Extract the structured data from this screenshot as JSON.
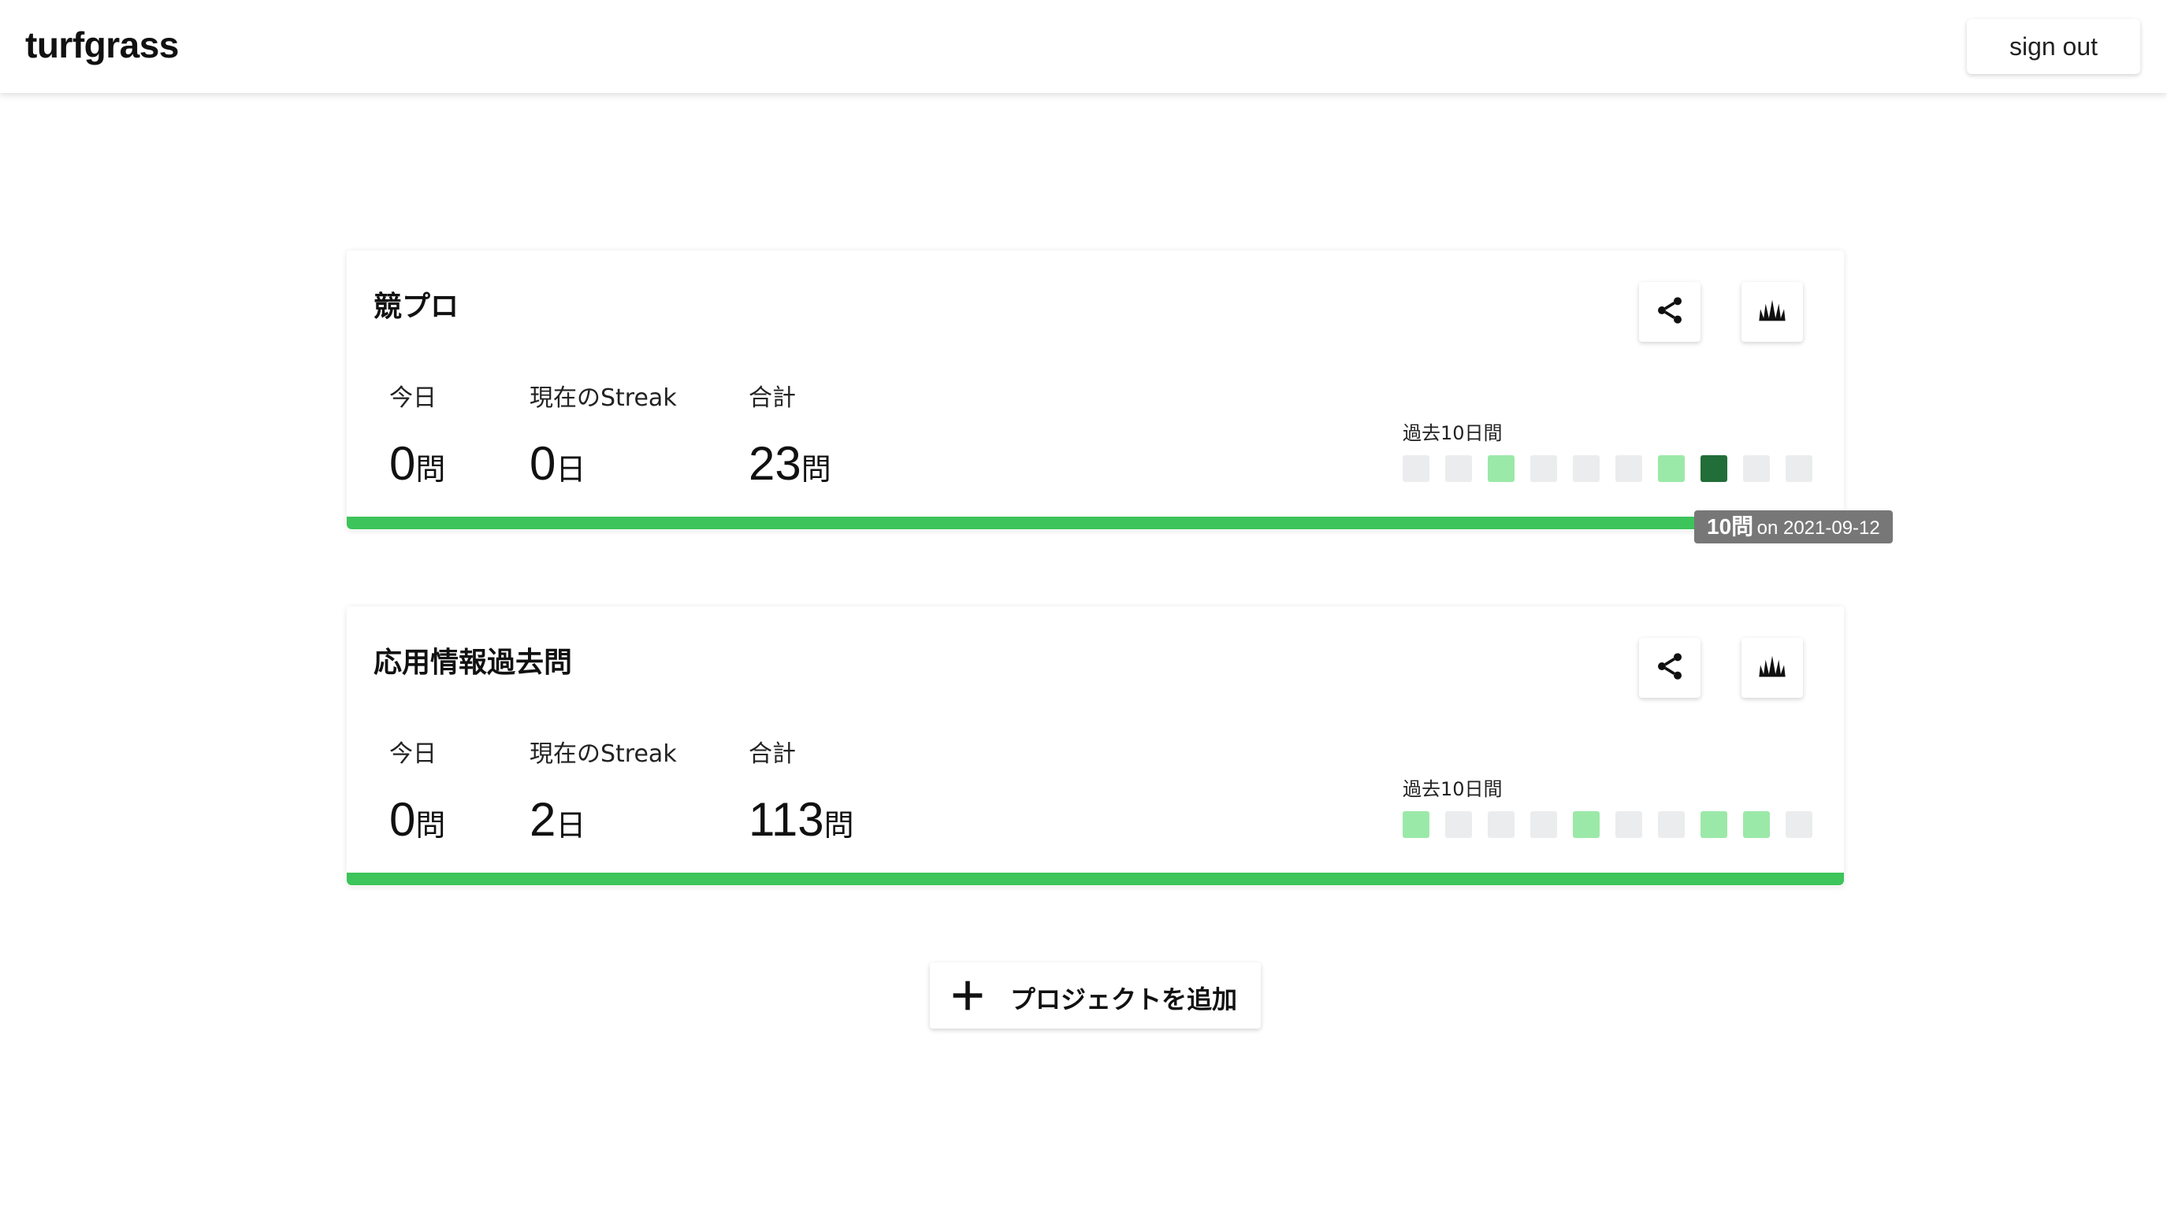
{
  "app": {
    "title": "turfgrass"
  },
  "header": {
    "sign_out_label": "sign out"
  },
  "colors": {
    "accent": "#3dc45a",
    "cell_empty": "#eaecee",
    "cell_light": "#9be9a8",
    "cell_dark": "#216e39",
    "tooltip_bg": "#777777"
  },
  "projects": [
    {
      "name": "競プロ",
      "stats": [
        {
          "label": "今日",
          "value": "0",
          "unit": "問"
        },
        {
          "label": "現在のStreak",
          "value": "0",
          "unit": "日"
        },
        {
          "label": "合計",
          "value": "23",
          "unit": "問"
        }
      ],
      "history_label": "過去10日間",
      "history": [
        "empty",
        "empty",
        "light",
        "empty",
        "empty",
        "empty",
        "light",
        "dark",
        "empty",
        "empty"
      ],
      "progress": 1.0
    },
    {
      "name": "応用情報過去問",
      "stats": [
        {
          "label": "今日",
          "value": "0",
          "unit": "問"
        },
        {
          "label": "現在のStreak",
          "value": "2",
          "unit": "日"
        },
        {
          "label": "合計",
          "value": "113",
          "unit": "問"
        }
      ],
      "history_label": "過去10日間",
      "history": [
        "light",
        "empty",
        "empty",
        "empty",
        "light",
        "empty",
        "empty",
        "light",
        "light",
        "empty"
      ],
      "progress": 1.0
    }
  ],
  "tooltip": {
    "count": "10問",
    "date_text": "on 2021-09-12"
  },
  "add_project_label": "プロジェクトを追加",
  "icons": {
    "share": "share-icon",
    "grass": "grass-icon",
    "plus": "plus-icon"
  }
}
